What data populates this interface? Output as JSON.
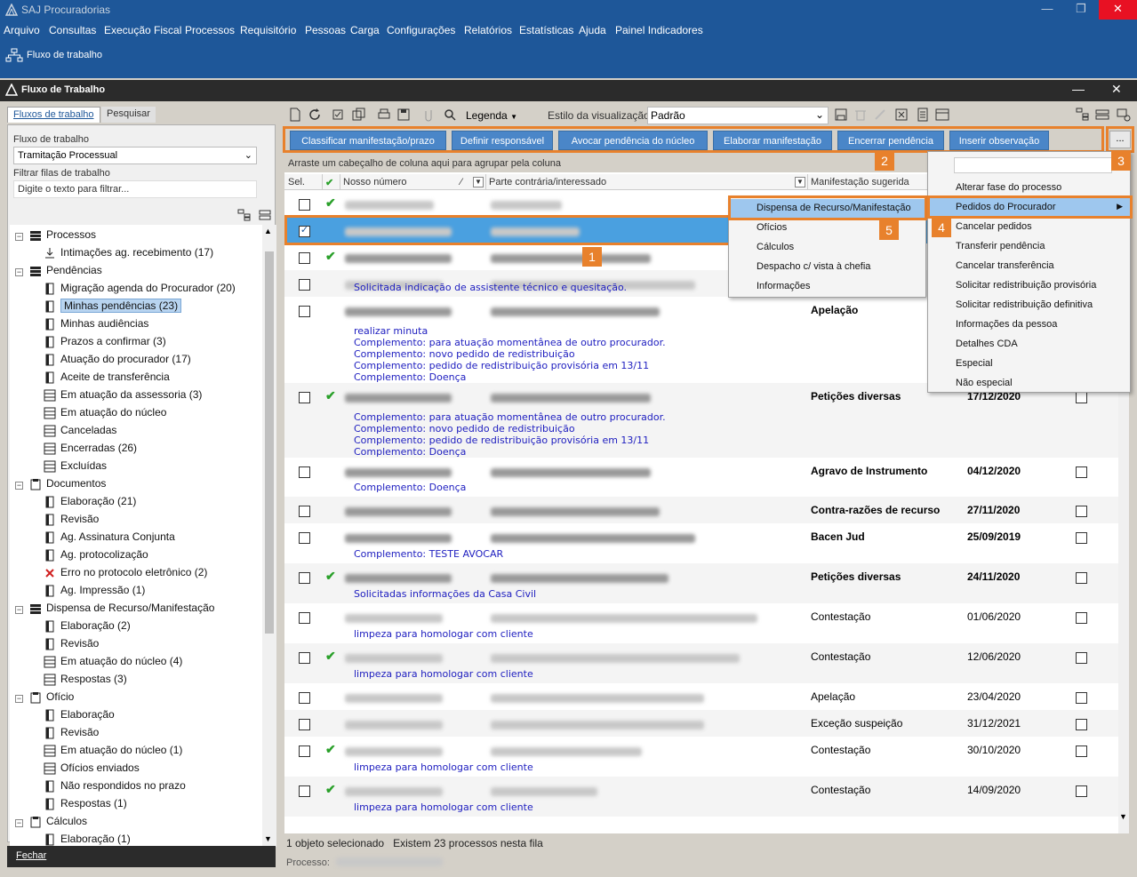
{
  "app": {
    "title": "SAJ Procuradorias",
    "menu": [
      "Arquivo",
      "Consultas",
      "Execução Fiscal",
      "Processos",
      "Requisitório",
      "Pessoas",
      "Carga",
      "Configurações",
      "Relatórios",
      "Estatísticas",
      "Ajuda",
      "Painel Indicadores"
    ],
    "toolbar_label": "Fluxo de trabalho",
    "child_title": "Fluxo de Trabalho"
  },
  "left": {
    "tabs": [
      "Fluxos de trabalho",
      "Pesquisar"
    ],
    "flow_label": "Fluxo de trabalho",
    "flow_value": "Tramitação Processual",
    "filter_label": "Filtrar filas de trabalho",
    "filter_placeholder": "Digite o texto para filtrar...",
    "close": "Fechar",
    "tree": [
      {
        "label": "Processos",
        "level": 0,
        "icon": "list"
      },
      {
        "label": "Intimações ag. recebimento (17)",
        "level": 1,
        "icon": "download"
      },
      {
        "label": "Pendências",
        "level": 0,
        "icon": "list"
      },
      {
        "label": "Migração agenda do Procurador (20)",
        "level": 1,
        "icon": "doc"
      },
      {
        "label": "Minhas pendências (23)",
        "level": 1,
        "icon": "doc",
        "selected": true
      },
      {
        "label": "Minhas audiências",
        "level": 1,
        "icon": "doc"
      },
      {
        "label": "Prazos a confirmar (3)",
        "level": 1,
        "icon": "doc"
      },
      {
        "label": "Atuação do procurador (17)",
        "level": 1,
        "icon": "doc"
      },
      {
        "label": "Aceite de transferência",
        "level": 1,
        "icon": "doc"
      },
      {
        "label": "Em atuação da assessoria (3)",
        "level": 1,
        "icon": "grid"
      },
      {
        "label": "Em atuação do núcleo",
        "level": 1,
        "icon": "grid"
      },
      {
        "label": "Canceladas",
        "level": 1,
        "icon": "grid"
      },
      {
        "label": "Encerradas (26)",
        "level": 1,
        "icon": "grid"
      },
      {
        "label": "Excluídas",
        "level": 1,
        "icon": "grid"
      },
      {
        "label": "Documentos",
        "level": 0,
        "icon": "clip"
      },
      {
        "label": "Elaboração (21)",
        "level": 1,
        "icon": "doc"
      },
      {
        "label": "Revisão",
        "level": 1,
        "icon": "doc"
      },
      {
        "label": "Ag. Assinatura Conjunta",
        "level": 1,
        "icon": "doc"
      },
      {
        "label": "Ag. protocolização",
        "level": 1,
        "icon": "doc"
      },
      {
        "label": "Erro no protocolo eletrônico (2)",
        "level": 1,
        "icon": "error"
      },
      {
        "label": "Ag. Impressão (1)",
        "level": 1,
        "icon": "doc"
      },
      {
        "label": "Dispensa de Recurso/Manifestação",
        "level": 0,
        "icon": "list"
      },
      {
        "label": "Elaboração (2)",
        "level": 1,
        "icon": "doc"
      },
      {
        "label": "Revisão",
        "level": 1,
        "icon": "doc"
      },
      {
        "label": "Em atuação do núcleo (4)",
        "level": 1,
        "icon": "grid"
      },
      {
        "label": "Respostas (3)",
        "level": 1,
        "icon": "grid"
      },
      {
        "label": "Ofício",
        "level": 0,
        "icon": "clip"
      },
      {
        "label": "Elaboração",
        "level": 1,
        "icon": "doc"
      },
      {
        "label": "Revisão",
        "level": 1,
        "icon": "doc"
      },
      {
        "label": "Em atuação do núcleo (1)",
        "level": 1,
        "icon": "grid"
      },
      {
        "label": "Ofícios enviados",
        "level": 1,
        "icon": "grid"
      },
      {
        "label": "Não respondidos no prazo",
        "level": 1,
        "icon": "doc"
      },
      {
        "label": "Respostas (1)",
        "level": 1,
        "icon": "doc"
      },
      {
        "label": "Cálculos",
        "level": 0,
        "icon": "clip"
      },
      {
        "label": "Elaboração (1)",
        "level": 1,
        "icon": "doc"
      }
    ]
  },
  "toolbar": {
    "legenda": "Legenda",
    "estilo_label": "Estilo da visualização",
    "estilo_value": "Padrão"
  },
  "actions": [
    "Classificar manifestação/prazo",
    "Definir responsável",
    "Avocar pendência do núcleo",
    "Elaborar manifestação",
    "Encerrar pendência",
    "Inserir observação"
  ],
  "more_label": "...",
  "grid": {
    "group_hint": "Arraste um cabeçalho de coluna aqui para agrupar pela coluna",
    "headers": {
      "sel": "Sel.",
      "numero": "Nosso número",
      "parte": "Parte contrária/interessado",
      "manif": "Manifestação sugerida"
    },
    "rows": [
      {
        "check": true,
        "manif": "",
        "date": "",
        "notes": [],
        "bold": false
      },
      {
        "check": false,
        "manif": "",
        "date": "",
        "notes": [],
        "bold": false,
        "selected": true
      },
      {
        "check": true,
        "manif": "",
        "date": "",
        "notes": [],
        "bold": true
      },
      {
        "check": false,
        "manif": "",
        "date": "",
        "notes": [
          "Solicitada indicação de assistente técnico e quesitação."
        ],
        "bold": false
      },
      {
        "check": false,
        "manif": "Apelação",
        "date": "",
        "notes": [
          "realizar minuta",
          "Complemento: para atuação momentânea de outro procurador.",
          "Complemento: novo pedido de redistribuição",
          "Complemento: pedido de redistribuição provisória em 13/11",
          "Complemento: Doença"
        ],
        "bold": true
      },
      {
        "check": true,
        "manif": "Petições diversas",
        "date": "17/12/2020",
        "notes": [
          "Complemento: para atuação momentânea de outro procurador.",
          "Complemento: novo pedido de redistribuição",
          "Complemento: pedido de redistribuição provisória em 13/11",
          "Complemento: Doença"
        ],
        "bold": true
      },
      {
        "check": false,
        "manif": "Agravo de Instrumento",
        "date": "04/12/2020",
        "notes": [
          "Complemento: Doença"
        ],
        "bold": true
      },
      {
        "check": false,
        "manif": "Contra-razões de recurso",
        "date": "27/11/2020",
        "notes": [],
        "bold": true
      },
      {
        "check": false,
        "manif": "Bacen Jud",
        "date": "25/09/2019",
        "notes": [
          "Complemento: TESTE AVOCAR"
        ],
        "bold": true
      },
      {
        "check": true,
        "manif": "Petições diversas",
        "date": "24/11/2020",
        "notes": [
          "Solicitadas informações da Casa Civil"
        ],
        "bold": true
      },
      {
        "check": false,
        "manif": "Contestação",
        "date": "01/06/2020",
        "notes": [
          "limpeza para homologar com cliente"
        ],
        "bold": false
      },
      {
        "check": true,
        "manif": "Contestação",
        "date": "12/06/2020",
        "notes": [
          "limpeza para homologar com cliente"
        ],
        "bold": false
      },
      {
        "check": false,
        "manif": "Apelação",
        "date": "23/04/2020",
        "notes": [],
        "bold": false
      },
      {
        "check": false,
        "manif": "Exceção suspeição",
        "date": "31/12/2021",
        "notes": [],
        "bold": false
      },
      {
        "check": true,
        "manif": "Contestação",
        "date": "30/10/2020",
        "notes": [
          "limpeza para homologar com cliente"
        ],
        "bold": false
      },
      {
        "check": true,
        "manif": "Contestação",
        "date": "14/09/2020",
        "notes": [
          "limpeza para homologar com cliente"
        ],
        "bold": false
      }
    ]
  },
  "status": {
    "selected": "1 objeto selecionado",
    "count": "Existem 23 processos nesta fila",
    "processo": "Processo:"
  },
  "submenu": [
    "Dispensa de Recurso/Manifestação",
    "Ofícios",
    "Cálculos",
    "Despacho c/ vista à chefia",
    "Informações"
  ],
  "moremenu": [
    "Alterar fase do processo",
    "Pedidos do Procurador",
    "Cancelar pedidos",
    "Transferir pendência",
    "Cancelar transferência",
    "Solicitar redistribuição provisória",
    "Solicitar redistribuição definitiva",
    "Informações da pessoa",
    "Detalhes CDA",
    "Especial",
    "Não especial"
  ],
  "badges": [
    "1",
    "2",
    "3",
    "4",
    "5"
  ]
}
